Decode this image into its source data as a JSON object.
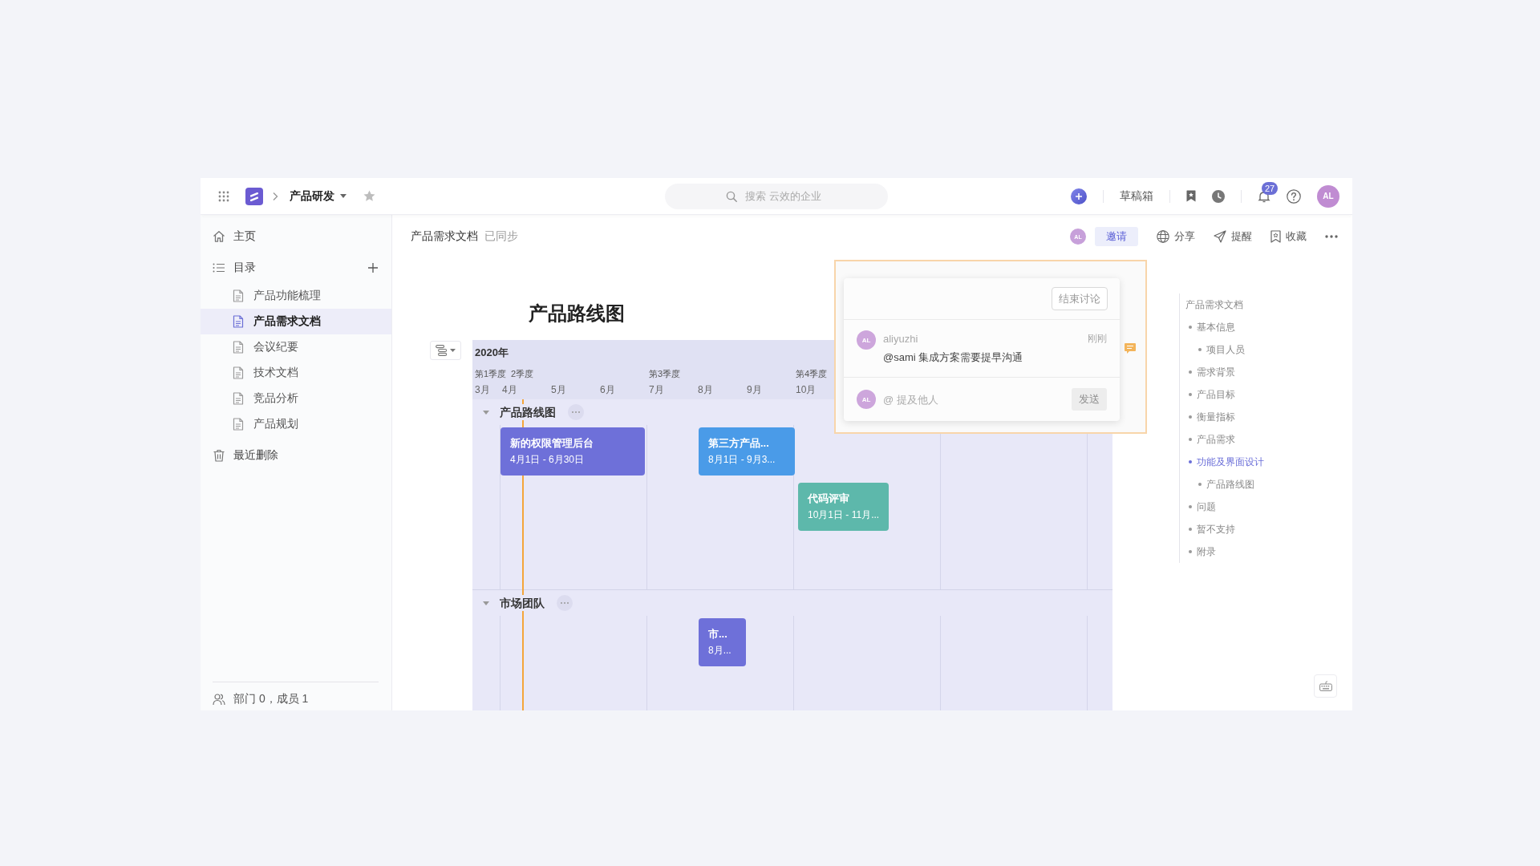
{
  "topbar": {
    "project": "产品研发",
    "search": {
      "placeholder": "搜索 云效的企业"
    },
    "drafts": "草稿箱",
    "notification_badge": "27",
    "avatar": "AL"
  },
  "sidebar": {
    "home": "主页",
    "catalog": {
      "label": "目录",
      "items": [
        {
          "label": "产品功能梳理",
          "selected": false
        },
        {
          "label": "产品需求文档",
          "selected": true
        },
        {
          "label": "会议纪要",
          "selected": false
        },
        {
          "label": "技术文档",
          "selected": false
        },
        {
          "label": "竞品分析",
          "selected": false
        },
        {
          "label": "产品规划",
          "selected": false
        }
      ]
    },
    "trash": "最近删除",
    "footer": "部门 0，成员 1"
  },
  "document": {
    "breadcrumb": "产品需求文档",
    "sync_status": "已同步",
    "collaborator_avatar": "AL",
    "actions": [
      {
        "kind": "invite",
        "label": "邀请"
      },
      {
        "kind": "share",
        "label": "分享"
      },
      {
        "kind": "remind",
        "label": "提醒"
      },
      {
        "kind": "favorite",
        "label": "收藏"
      },
      {
        "kind": "more"
      }
    ],
    "title": "产品路线图"
  },
  "roadmap": {
    "year": "2020年",
    "quarters": [
      {
        "label": "第1季度",
        "months": [
          "3月"
        ]
      },
      {
        "label": "2季度",
        "months": [
          "4月",
          "5月",
          "6月"
        ]
      },
      {
        "label": "第3季度",
        "months": [
          "7月",
          "8月",
          "9月"
        ]
      },
      {
        "label": "第4季度",
        "months": [
          "10月"
        ]
      }
    ],
    "sections": [
      {
        "title": "产品路线图",
        "bars": [
          {
            "title": "新的权限管理后台",
            "dates": "4月1日 - 6月30日",
            "color": "#6e70d9"
          },
          {
            "title": "第三方产品...",
            "dates": "8月1日 - 9月3...",
            "color": "#4a9be8"
          },
          {
            "title": "代码评审",
            "dates": "10月1日 - 11月...",
            "color": "#5db8ab"
          }
        ]
      },
      {
        "title": "市场团队",
        "bars": [
          {
            "title": "市...",
            "dates": "8月...",
            "color": "#6e70d9"
          }
        ]
      }
    ]
  },
  "comment_thread": {
    "end_button": "结束讨论",
    "comments": [
      {
        "avatar": "AL",
        "author": "aliyuzhi",
        "time": "刚刚",
        "text": "@sami 集成方案需要提早沟通"
      }
    ],
    "reply": {
      "avatar": "AL",
      "placeholder": "@ 提及他人",
      "send_button": {
        "label": "发送",
        "disabled": true
      }
    }
  },
  "outline": {
    "title": "产品需求文档",
    "items": [
      {
        "label": "基本信息",
        "selected": false,
        "children": [
          {
            "label": "项目人员",
            "selected": false
          }
        ]
      },
      {
        "label": "需求背景",
        "selected": false
      },
      {
        "label": "产品目标",
        "selected": false
      },
      {
        "label": "衡量指标",
        "selected": false
      },
      {
        "label": "产品需求",
        "selected": false
      },
      {
        "label": "功能及界面设计",
        "selected": true,
        "children": [
          {
            "label": "产品路线图",
            "selected": false
          }
        ]
      },
      {
        "label": "问题",
        "selected": false
      },
      {
        "label": "暂不支持",
        "selected": false
      },
      {
        "label": "附录",
        "selected": false
      }
    ]
  }
}
